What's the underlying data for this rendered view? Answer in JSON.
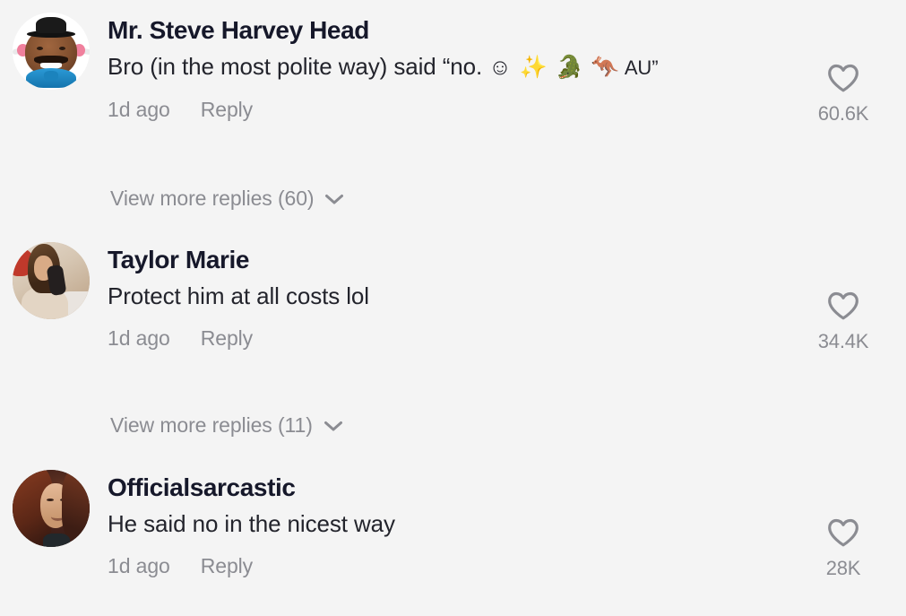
{
  "app": "tiktok-comment-list",
  "theme": {
    "background": "#f4f4f4",
    "username_color": "#16182a",
    "comment_color": "#23242c",
    "muted_color": "#8b8c92"
  },
  "comments": [
    {
      "id": "comment-1",
      "username": "Mr. Steve Harvey Head",
      "avatar": "mr-potato-head-steve-harvey",
      "text_prefix": "Bro (in the most polite way) said “no. ",
      "emojis": "☺ ✨ 🐊 🦘",
      "text_suffix": " AU”",
      "full_text": "Bro (in the most polite way) said “no. ☺ ✨ 🐊 🦘 AU”",
      "time": "1d ago",
      "reply_label": "Reply",
      "like_count": "60.6K",
      "like_icon": "heart-outline-icon",
      "view_more": {
        "label": "View more replies (60)",
        "count": 60,
        "icon": "chevron-down-icon"
      }
    },
    {
      "id": "comment-2",
      "username": "Taylor Marie",
      "avatar": "woman-mirror-selfie",
      "text_prefix": "Protect him at all costs lol",
      "emojis": "",
      "text_suffix": "",
      "full_text": "Protect him at all costs lol",
      "time": "1d ago",
      "reply_label": "Reply",
      "like_count": "34.4K",
      "like_icon": "heart-outline-icon",
      "view_more": {
        "label": "View more replies (11)",
        "count": 11,
        "icon": "chevron-down-icon"
      }
    },
    {
      "id": "comment-3",
      "username": "Officialsarcastic",
      "avatar": "woman-auburn-hair-smiling",
      "text_prefix": "He said no in the nicest way",
      "emojis": "",
      "text_suffix": "",
      "full_text": "He said no in the nicest way",
      "time": "1d ago",
      "reply_label": "Reply",
      "like_count": "28K",
      "like_icon": "heart-outline-icon",
      "view_more": null
    }
  ]
}
